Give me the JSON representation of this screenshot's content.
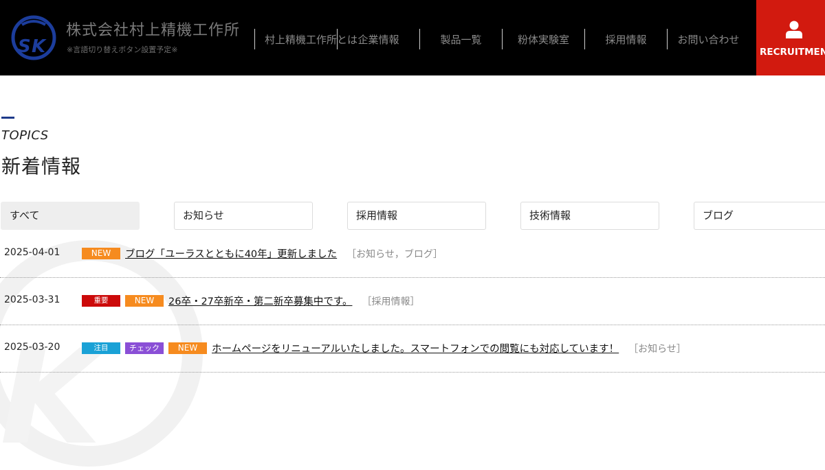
{
  "header": {
    "company_name": "株式会社村上精機工作所",
    "company_sub": "※言語切り替えボタン設置予定※",
    "nav": [
      {
        "label": "村上精機工作所とは"
      },
      {
        "label": "企業情報"
      },
      {
        "label": "製品一覧"
      },
      {
        "label": "粉体実験室"
      },
      {
        "label": "採用情報"
      },
      {
        "label": "お問い合わせ"
      }
    ],
    "recruit_label": "RECRUITMENT"
  },
  "topics": {
    "en_label": "TOPICS",
    "title": "新着情報",
    "tabs": [
      {
        "label": "すべて",
        "active": true
      },
      {
        "label": "お知らせ",
        "active": false
      },
      {
        "label": "採用情報",
        "active": false
      },
      {
        "label": "技術情報",
        "active": false
      },
      {
        "label": "ブログ",
        "active": false
      }
    ],
    "news": [
      {
        "date": "2025-04-01",
        "badges": [
          "NEW"
        ],
        "title": "ブログ「ユーラスとともに40年」更新しました",
        "category": "［お知らせ，ブログ］"
      },
      {
        "date": "2025-03-31",
        "badges": [
          "重要",
          "NEW"
        ],
        "title": "26卒・27卒新卒・第二新卒募集中です。",
        "category": "［採用情報］"
      },
      {
        "date": "2025-03-20",
        "badges": [
          "注目",
          "チェック",
          "NEW"
        ],
        "title": "ホームページをリニューアルいたしました。スマートフォンでの閲覧にも対応しています！",
        "category": "［お知らせ］"
      }
    ]
  },
  "colors": {
    "header_bg": "#000000",
    "recruit_bg": "#d21a0f",
    "accent": "#1e3a8a",
    "badge_new": "#f68b1f",
    "badge_important": "#cc0a0a",
    "badge_attention": "#1aa1d6",
    "badge_check": "#8a4fd6"
  }
}
